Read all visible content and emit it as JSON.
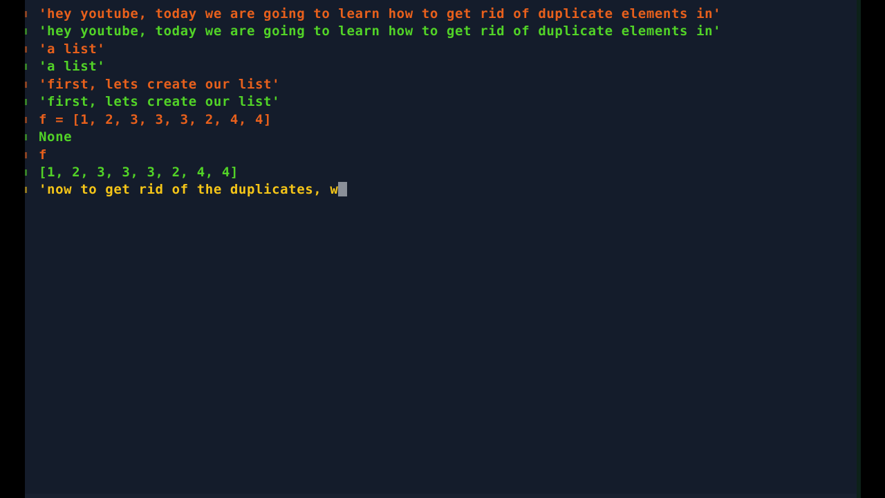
{
  "window": {
    "title": "Python interactive shell",
    "background_color": "#141c2b",
    "outer_background_color": "#000000",
    "edge_strip_color": "#0d2119"
  },
  "palette": {
    "input_orange": "#e8601c",
    "output_green": "#52d327",
    "string_yellow": "#f5c518",
    "cursor_grey": "#8a8f98"
  },
  "terminal": {
    "cursor": {
      "name": "block-cursor",
      "color": "#8a8f98",
      "line_index": 10,
      "after_text": "'now to get rid of the duplicates, w"
    },
    "lines": [
      {
        "text": "'hey youtube, today we are going to learn how to get rid of duplicate elements in'",
        "color": "#e8601c",
        "kind": "input",
        "gutter": true,
        "cursor": false
      },
      {
        "text": "'hey youtube, today we are going to learn how to get rid of duplicate elements in'",
        "color": "#52d327",
        "kind": "output",
        "gutter": true,
        "cursor": false
      },
      {
        "text": "'a list'",
        "color": "#e8601c",
        "kind": "input",
        "gutter": true,
        "cursor": false
      },
      {
        "text": "'a list'",
        "color": "#52d327",
        "kind": "output",
        "gutter": true,
        "cursor": false
      },
      {
        "text": "'first, lets create our list'",
        "color": "#e8601c",
        "kind": "input",
        "gutter": true,
        "cursor": false
      },
      {
        "text": "'first, lets create our list'",
        "color": "#52d327",
        "kind": "output",
        "gutter": true,
        "cursor": false
      },
      {
        "text": "f = [1, 2, 3, 3, 3, 2, 4, 4]",
        "color": "#e8601c",
        "kind": "input",
        "gutter": true,
        "cursor": false
      },
      {
        "text": "None",
        "color": "#52d327",
        "kind": "output",
        "gutter": true,
        "cursor": false
      },
      {
        "text": "f",
        "color": "#e8601c",
        "kind": "input",
        "gutter": true,
        "cursor": false
      },
      {
        "text": "[1, 2, 3, 3, 3, 2, 4, 4]",
        "color": "#52d327",
        "kind": "output",
        "gutter": true,
        "cursor": false
      },
      {
        "text": "'now to get rid of the duplicates, w",
        "color": "#f5c518",
        "kind": "typing",
        "gutter": true,
        "cursor": true
      }
    ]
  }
}
